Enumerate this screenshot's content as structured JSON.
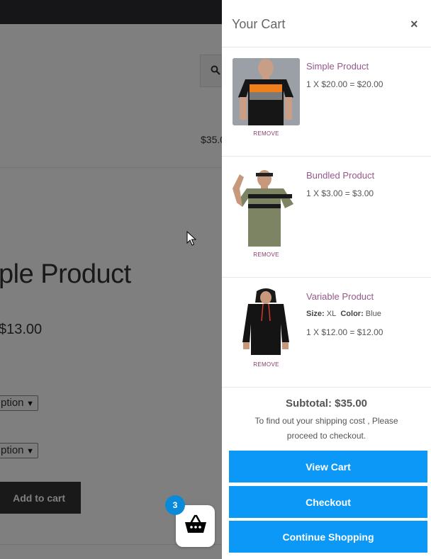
{
  "page": {
    "header_price": "$35.0",
    "product_title": "ple Product",
    "product_price": "$13.00",
    "option_selects": [
      "ption",
      "ption"
    ],
    "add_to_cart_label": "Add to cart"
  },
  "basket": {
    "count": "3",
    "badge_color": "#0a8ad8"
  },
  "cart": {
    "title": "Your Cart",
    "close_label": "×",
    "remove_label": "REMOVE",
    "items": [
      {
        "name": "Simple Product",
        "qty_line": "1 X $20.00 = $20.00",
        "image": "tshirt-black-orange-stripe"
      },
      {
        "name": "Bundled Product",
        "qty_line": "1 X $3.00 = $3.00",
        "image": "tshirt-olive-black-stripes"
      },
      {
        "name": "Variable Product",
        "meta": {
          "size_label": "Size:",
          "size_value": "XL",
          "color_label": "Color:",
          "color_value": "Blue"
        },
        "qty_line": "1 X $12.00 = $12.00",
        "image": "hoodie-black-red-strings"
      }
    ],
    "subtotal": "Subtotal: $35.00",
    "shipping_note": "To find out your shipping cost , Please proceed to checkout.",
    "buttons": {
      "view_cart": "View Cart",
      "checkout": "Checkout",
      "continue": "Continue Shopping"
    },
    "accent_color": "#0b98f6",
    "link_color": "#96588a"
  }
}
